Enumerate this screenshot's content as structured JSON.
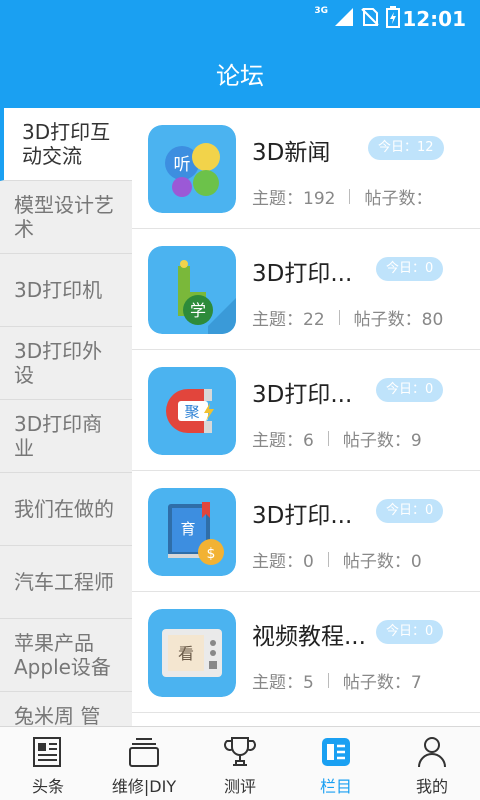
{
  "status_bar": {
    "network": "3G",
    "time": "12:01"
  },
  "header": {
    "title": "论坛"
  },
  "sidebar": {
    "items": [
      {
        "label": "3D打印互动交流",
        "active": true
      },
      {
        "label": "模型设计艺术",
        "active": false
      },
      {
        "label": "3D打印机",
        "active": false
      },
      {
        "label": "3D打印外设",
        "active": false
      },
      {
        "label": "3D打印商业",
        "active": false
      },
      {
        "label": "我们在做的",
        "active": false
      },
      {
        "label": "汽车工程师",
        "active": false
      },
      {
        "label": "苹果产品Apple设备",
        "active": false
      },
      {
        "label": "兔米周 管理",
        "active": false
      }
    ]
  },
  "forums": [
    {
      "name": "3D新闻",
      "today": "今日：12",
      "topics": "主题：192",
      "posts": "帖子数：",
      "icon": "listen-bubbles-icon"
    },
    {
      "name": "3D打印...",
      "today": "今日：0",
      "topics": "主题：22",
      "posts": "帖子数：80",
      "icon": "study-hand-icon"
    },
    {
      "name": "3D打印...",
      "today": "今日：0",
      "topics": "主题：6",
      "posts": "帖子数：9",
      "icon": "magnet-gather-icon"
    },
    {
      "name": "3D打印...",
      "today": "今日：0",
      "topics": "主题：0",
      "posts": "帖子数：0",
      "icon": "book-coin-icon"
    },
    {
      "name": "视频教程...",
      "today": "今日：0",
      "topics": "主题：5",
      "posts": "帖子数：7",
      "icon": "tv-watch-icon"
    }
  ],
  "tabs": [
    {
      "label": "头条",
      "icon": "newspaper-icon",
      "active": false
    },
    {
      "label": "维修|DIY",
      "icon": "stack-icon",
      "active": false
    },
    {
      "label": "测评",
      "icon": "trophy-icon",
      "active": false
    },
    {
      "label": "栏目",
      "icon": "column-icon",
      "active": true
    },
    {
      "label": "我的",
      "icon": "person-icon",
      "active": false
    }
  ],
  "colors": {
    "primary": "#1aa0f2",
    "badge": "#bfe3fb",
    "icon_tile": "#4bb3f0"
  }
}
